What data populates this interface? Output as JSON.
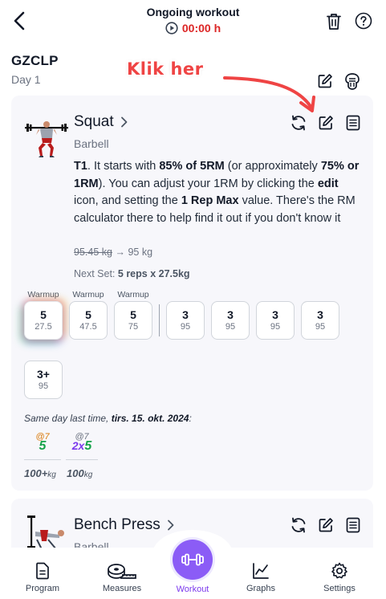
{
  "header": {
    "title": "Ongoing workout",
    "timer": "00:00 h"
  },
  "program": {
    "name": "GZCLP",
    "day": "Day 1"
  },
  "annotation": {
    "text": "Klik her"
  },
  "exercise1": {
    "name": "Squat",
    "equipment": "Barbell",
    "description": {
      "tier": "T1",
      "p1": ". It starts with ",
      "b1": "85% of 5RM",
      "p2": " (or approximately ",
      "b2": "75% or 1RM",
      "p3": "). You can adjust your 1RM by clicking the ",
      "b3": "edit",
      "p4": " icon, and setting the ",
      "b4": "1 Rep Max",
      "p5": " value. There's the RM calculator there to help find it out if you don't know it"
    },
    "weight_old": "95.45 kg",
    "weight_arrow": "→",
    "weight_new": "95 kg",
    "next_set_label": "Next Set: ",
    "next_set_value": "5 reps x 27.5kg",
    "warmup_label": "Warmup",
    "sets": [
      {
        "reps": "5",
        "weight": "27.5",
        "warmup": true
      },
      {
        "reps": "5",
        "weight": "47.5",
        "warmup": true
      },
      {
        "reps": "5",
        "weight": "75",
        "warmup": true
      },
      {
        "reps": "3",
        "weight": "95",
        "warmup": false
      },
      {
        "reps": "3",
        "weight": "95",
        "warmup": false
      },
      {
        "reps": "3",
        "weight": "95",
        "warmup": false
      },
      {
        "reps": "3",
        "weight": "95",
        "warmup": false
      },
      {
        "reps": "3+",
        "weight": "95",
        "warmup": false
      }
    ],
    "last_time_prefix": "Same day last time, ",
    "last_time_date": "tirs. 15. okt. 2024",
    "last_time_suffix": ":",
    "history": [
      {
        "rpe": "@7",
        "reps_prefix": "",
        "reps": "5",
        "weight": "100+",
        "unit": "kg"
      },
      {
        "rpe": "@7",
        "reps_prefix": "2x",
        "reps": "5",
        "weight": "100",
        "unit": "kg"
      }
    ]
  },
  "exercise2": {
    "name": "Bench Press",
    "equipment": "Barbell"
  },
  "nav": {
    "program": "Program",
    "measures": "Measures",
    "workout": "Workout",
    "graphs": "Graphs",
    "settings": "Settings"
  },
  "colors": {
    "timer": "#dc2626",
    "accent": "#8b5cf6",
    "annotation": "#ef4444",
    "rpe": "#d97706",
    "reps_green": "#16a34a",
    "reps_prefix": "#7c3aed"
  }
}
